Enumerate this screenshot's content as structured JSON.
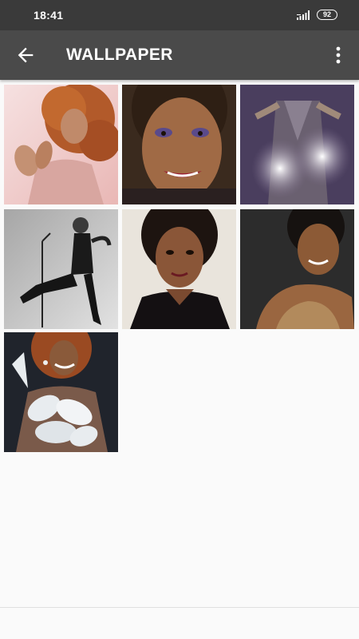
{
  "status_bar": {
    "time": "18:41",
    "battery": "92"
  },
  "app_bar": {
    "title": "WALLPAPER",
    "back_icon": "arrow-back-icon",
    "menu_icon": "more-vert-icon"
  },
  "wallpapers": [
    {
      "name": "wallpaper-1"
    },
    {
      "name": "wallpaper-2"
    },
    {
      "name": "wallpaper-3"
    },
    {
      "name": "wallpaper-4"
    },
    {
      "name": "wallpaper-5"
    },
    {
      "name": "wallpaper-6"
    },
    {
      "name": "wallpaper-7"
    }
  ],
  "colors": {
    "status_bar": "#3a3a3a",
    "app_bar": "#4a4a4a",
    "background": "#fafafa"
  }
}
